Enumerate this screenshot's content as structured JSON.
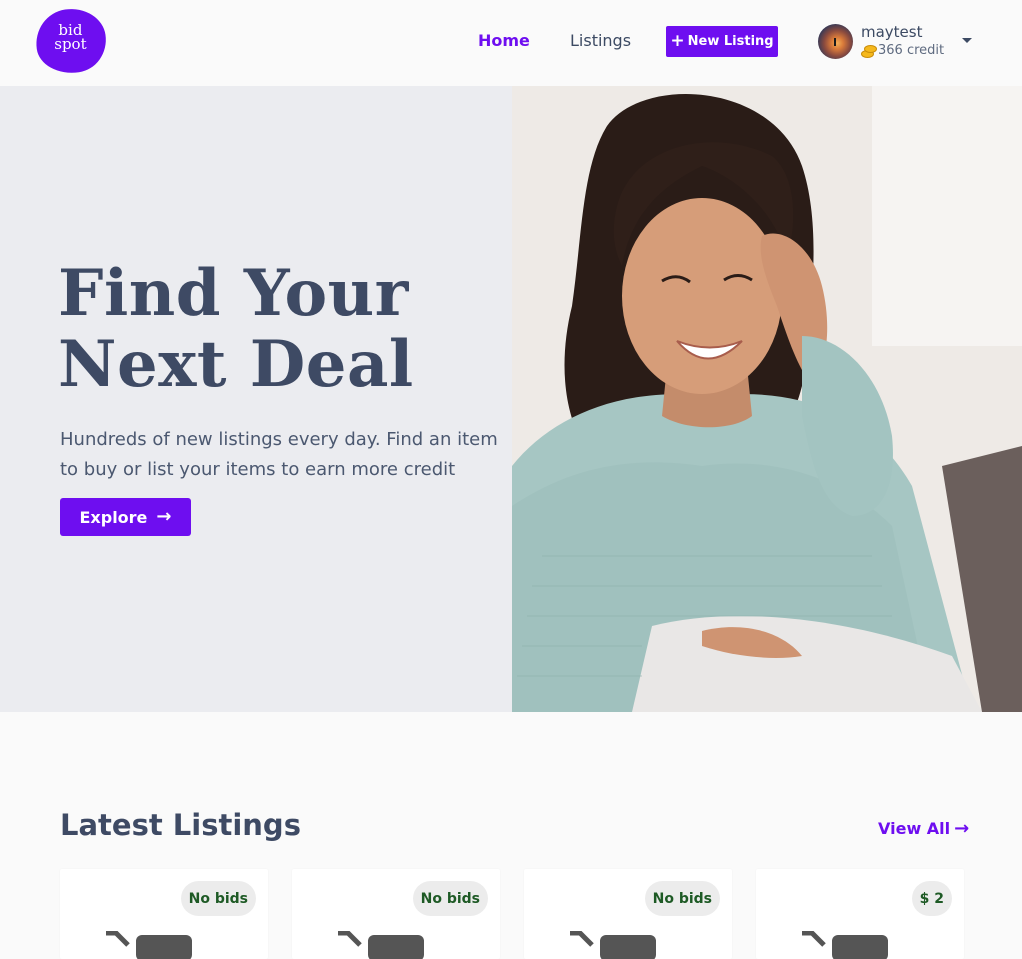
{
  "brand": {
    "logo_line1": "bid",
    "logo_line2": "spot",
    "accent_color": "#6e0ef0"
  },
  "nav": {
    "home": "Home",
    "listings": "Listings",
    "new_listing": "New Listing",
    "active": "Home"
  },
  "user": {
    "name": "maytest",
    "credit": "366 credit"
  },
  "hero": {
    "title_line1": "Find Your",
    "title_line2": "Next Deal",
    "subtitle": "Hundreds of new listings every day. Find an item to buy or list your items to earn more credit",
    "cta": "Explore"
  },
  "latest": {
    "title": "Latest Listings",
    "view_all": "View All",
    "cards": [
      {
        "badge": "No bids"
      },
      {
        "badge": "No bids"
      },
      {
        "badge": "No bids"
      },
      {
        "badge": "$ 2"
      }
    ]
  },
  "icons": {
    "plus": "plus-icon",
    "coins": "coins-icon",
    "caret": "caret-down-icon",
    "arrow": "arrow-right-icon",
    "image_placeholder": "image-placeholder-icon"
  }
}
